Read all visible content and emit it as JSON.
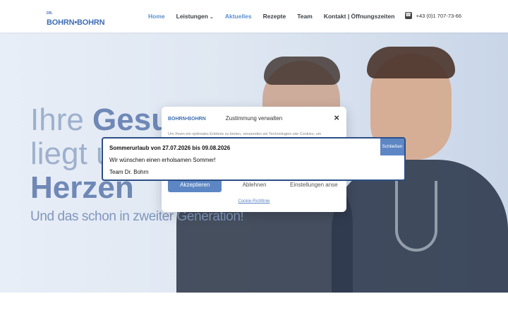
{
  "header": {
    "logo_small": "DR.",
    "logo_text": "BOHRN•BOHRN",
    "nav": [
      {
        "label": "Home",
        "active": true
      },
      {
        "label": "Leistungen",
        "has_dropdown": true
      },
      {
        "label": "Aktuelles",
        "active": true
      },
      {
        "label": "Rezepte"
      },
      {
        "label": "Team"
      },
      {
        "label": "Kontakt | Öffnungszeiten"
      }
    ],
    "phone_icon": "phone-icon",
    "phone": "+43 (0)1 707-73-66"
  },
  "hero": {
    "title_line1_light": "Ihre ",
    "title_line1_strong": "Gesun",
    "title_line2_light": "liegt u",
    "title_line3_strong": "Herzen",
    "subtitle": "Und das schon in zweiter Generation!"
  },
  "consent": {
    "logo_text": "BOHRN•BOHRN",
    "title": "Zustimmung verwalten",
    "close_icon": "close-icon",
    "text": "Um Ihnen ein optimales Erlebnis zu bieten, verwenden wir Technologien wie Cookies, um",
    "accept": "Akzeptieren",
    "decline": "Ablehnen",
    "settings": "Einstellungen anse",
    "policy_link": "Cookie-Richtlinie"
  },
  "notice": {
    "line1": "Sommerurlaub von 27.07.2026 bis 09.08.2026",
    "line2": "Wir wünschen einen erholsamen Sommer!",
    "line3": "Team Dr. Bohrn",
    "close": "Schließen"
  },
  "colors": {
    "accent": "#5d86c5",
    "notice_border": "#2b4f86",
    "nav_active": "#5b8fd0"
  }
}
